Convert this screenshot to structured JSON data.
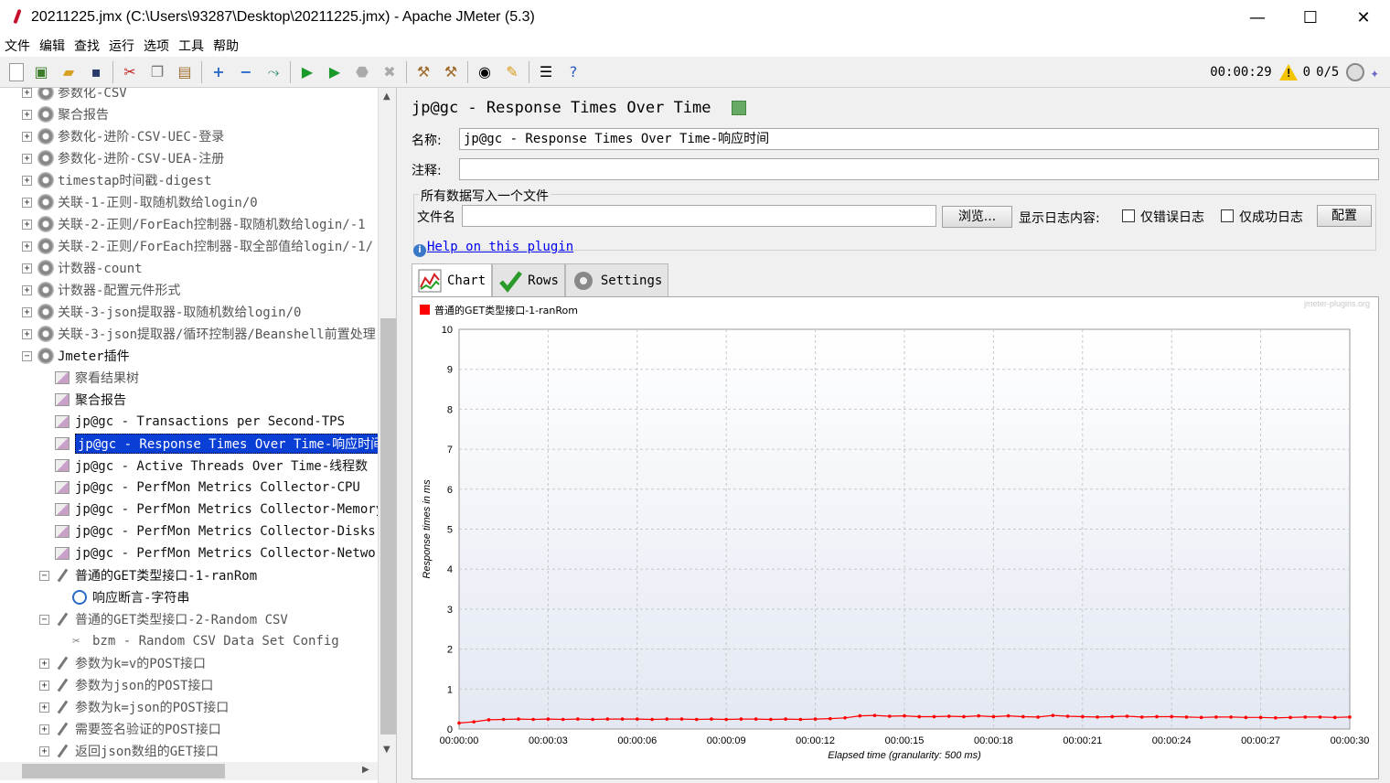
{
  "window": {
    "title": "20211225.jmx (C:\\Users\\93287\\Desktop\\20211225.jmx) - Apache JMeter (5.3)",
    "minimize": "—",
    "maximize": "☐",
    "close": "✕"
  },
  "menu": [
    "文件",
    "编辑",
    "查找",
    "运行",
    "选项",
    "工具",
    "帮助"
  ],
  "toolbar_status": {
    "elapsed": "00:00:29",
    "warnings": "0",
    "threads": "0/5"
  },
  "tree": {
    "items": [
      {
        "label": "参数化-CSV",
        "level": 0,
        "expander": "+",
        "icon": "gear-icon"
      },
      {
        "label": "聚合报告",
        "level": 0,
        "expander": "+",
        "icon": "gear-icon"
      },
      {
        "label": "参数化-进阶-CSV-UEC-登录",
        "level": 0,
        "expander": "+",
        "icon": "gear-icon"
      },
      {
        "label": "参数化-进阶-CSV-UEA-注册",
        "level": 0,
        "expander": "+",
        "icon": "gear-icon"
      },
      {
        "label": "timestap时间戳-digest",
        "level": 0,
        "expander": "+",
        "icon": "gear-icon"
      },
      {
        "label": "关联-1-正则-取随机数给login/0",
        "level": 0,
        "expander": "+",
        "icon": "gear-icon"
      },
      {
        "label": "关联-2-正则/ForEach控制器-取随机数给login/-1",
        "level": 0,
        "expander": "+",
        "icon": "gear-icon"
      },
      {
        "label": "关联-2-正则/ForEach控制器-取全部值给login/-1/",
        "level": 0,
        "expander": "+",
        "icon": "gear-icon"
      },
      {
        "label": "计数器-count",
        "level": 0,
        "expander": "+",
        "icon": "gear-icon"
      },
      {
        "label": "计数器-配置元件形式",
        "level": 0,
        "expander": "+",
        "icon": "gear-icon"
      },
      {
        "label": "关联-3-json提取器-取随机数给login/0",
        "level": 0,
        "expander": "+",
        "icon": "gear-icon"
      },
      {
        "label": "关联-3-json提取器/循环控制器/Beanshell前置处理",
        "level": 0,
        "expander": "+",
        "icon": "gear-icon"
      },
      {
        "label": "Jmeter插件",
        "level": 0,
        "expander": "−",
        "icon": "gear-icon",
        "dark": true
      },
      {
        "label": "察看结果树",
        "level": 1,
        "expander": "",
        "icon": "listener-icon"
      },
      {
        "label": "聚合报告",
        "level": 1,
        "expander": "",
        "icon": "listener-icon",
        "dark": true
      },
      {
        "label": "jp@gc - Transactions per Second-TPS",
        "level": 1,
        "expander": "",
        "icon": "graph-icon",
        "dark": true
      },
      {
        "label": "jp@gc - Response Times Over Time-响应时间",
        "level": 1,
        "expander": "",
        "icon": "graph-icon",
        "selected": true
      },
      {
        "label": "jp@gc - Active Threads Over Time-线程数",
        "level": 1,
        "expander": "",
        "icon": "graph-icon",
        "dark": true
      },
      {
        "label": "jp@gc - PerfMon Metrics Collector-CPU",
        "level": 1,
        "expander": "",
        "icon": "graph-icon",
        "dark": true
      },
      {
        "label": "jp@gc - PerfMon Metrics Collector-Memory",
        "level": 1,
        "expander": "",
        "icon": "graph-icon",
        "dark": true
      },
      {
        "label": "jp@gc - PerfMon Metrics Collector-Disks",
        "level": 1,
        "expander": "",
        "icon": "graph-icon",
        "dark": true
      },
      {
        "label": "jp@gc - PerfMon Metrics Collector-Network",
        "level": 1,
        "expander": "",
        "icon": "graph-icon",
        "dark": true
      },
      {
        "label": "普通的GET类型接口-1-ranRom",
        "level": 1,
        "expander": "−",
        "icon": "sampler-icon",
        "dark": true
      },
      {
        "label": "响应断言-字符串",
        "level": 2,
        "expander": "",
        "icon": "magnifier-icon",
        "dark": true
      },
      {
        "label": "普通的GET类型接口-2-Random CSV",
        "level": 1,
        "expander": "−",
        "icon": "sampler-icon"
      },
      {
        "label": "bzm - Random CSV Data Set Config",
        "level": 2,
        "expander": "",
        "icon": "scissors-icon"
      },
      {
        "label": "参数为k=v的POST接口",
        "level": 1,
        "expander": "+",
        "icon": "sampler-icon"
      },
      {
        "label": "参数为json的POST接口",
        "level": 1,
        "expander": "+",
        "icon": "sampler-icon"
      },
      {
        "label": "参数为k=json的POST接口",
        "level": 1,
        "expander": "+",
        "icon": "sampler-icon"
      },
      {
        "label": "需要签名验证的POST接口",
        "level": 1,
        "expander": "+",
        "icon": "sampler-icon"
      },
      {
        "label": "返回json数组的GET接口",
        "level": 1,
        "expander": "+",
        "icon": "sampler-icon"
      }
    ]
  },
  "panel": {
    "title": "jp@gc - Response Times Over Time",
    "name_label": "名称:",
    "name_value": "jp@gc - Response Times Over Time-响应时间",
    "comment_label": "注释:",
    "comment_value": "",
    "file_group_title": "所有数据写入一个文件",
    "filename_label": "文件名",
    "filename_value": "",
    "browse_button": "浏览...",
    "log_display_label": "显示日志内容:",
    "errors_only_label": "仅错误日志",
    "success_only_label": "仅成功日志",
    "config_button": "配置",
    "help_link": "Help on this plugin",
    "tabs": [
      "Chart",
      "Rows",
      "Settings"
    ]
  },
  "chart_data": {
    "type": "line",
    "watermark": "jmeter-plugins.org",
    "ylabel": "Response times in ms",
    "xlabel": "Elapsed time (granularity: 500 ms)",
    "ylim": [
      0,
      10
    ],
    "yticks": [
      "0",
      "1",
      "2",
      "3",
      "4",
      "5",
      "6",
      "7",
      "8",
      "9",
      "10"
    ],
    "xticks": [
      "00:00:00",
      "00:00:03",
      "00:00:06",
      "00:00:09",
      "00:00:12",
      "00:00:15",
      "00:00:18",
      "00:00:21",
      "00:00:24",
      "00:00:27",
      "00:00:30"
    ],
    "series": [
      {
        "name": "普通的GET类型接口-1-ranRom",
        "color": "#ff0000",
        "x": [
          0,
          0.5,
          1,
          1.5,
          2,
          2.5,
          3,
          3.5,
          4,
          4.5,
          5,
          5.5,
          6,
          6.5,
          7,
          7.5,
          8,
          8.5,
          9,
          9.5,
          10,
          10.5,
          11,
          11.5,
          12,
          12.5,
          13,
          13.5,
          14,
          14.5,
          15,
          15.5,
          16,
          16.5,
          17,
          17.5,
          18,
          18.5,
          19,
          19.5,
          20,
          20.5,
          21,
          21.5,
          22,
          22.5,
          23,
          23.5,
          24,
          24.5,
          25,
          25.5,
          26,
          26.5,
          27,
          27.5,
          28,
          28.5,
          29,
          29.5,
          30
        ],
        "y": [
          0.15,
          0.18,
          0.23,
          0.24,
          0.25,
          0.24,
          0.25,
          0.24,
          0.25,
          0.24,
          0.25,
          0.25,
          0.25,
          0.24,
          0.25,
          0.25,
          0.24,
          0.25,
          0.24,
          0.25,
          0.25,
          0.24,
          0.25,
          0.24,
          0.25,
          0.26,
          0.28,
          0.33,
          0.34,
          0.32,
          0.33,
          0.31,
          0.31,
          0.32,
          0.31,
          0.33,
          0.31,
          0.33,
          0.31,
          0.3,
          0.34,
          0.32,
          0.31,
          0.3,
          0.31,
          0.32,
          0.3,
          0.31,
          0.31,
          0.3,
          0.29,
          0.3,
          0.3,
          0.29,
          0.29,
          0.28,
          0.29,
          0.3,
          0.3,
          0.29,
          0.3
        ]
      }
    ]
  }
}
